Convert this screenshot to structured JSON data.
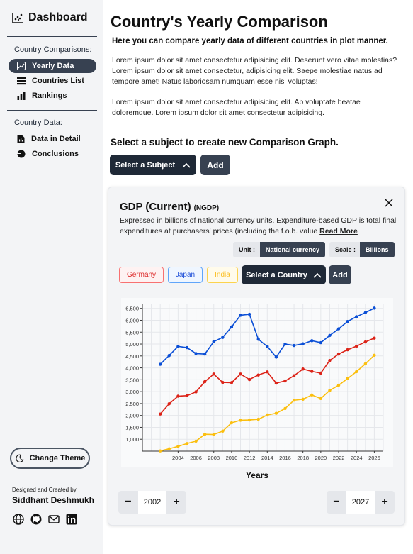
{
  "sidebar": {
    "brand": "Dashboard",
    "section1_title": "Country Comparisons:",
    "section1_items": [
      {
        "label": "Yearly Data",
        "icon": "chart-icon"
      },
      {
        "label": "Countries List",
        "icon": "list-icon"
      },
      {
        "label": "Rankings",
        "icon": "bar-chart-icon"
      }
    ],
    "section2_title": "Country Data:",
    "section2_items": [
      {
        "label": "Data in Detail",
        "icon": "document-icon"
      },
      {
        "label": "Conclusions",
        "icon": "pie-icon"
      }
    ],
    "theme_button": "Change Theme",
    "credit_small": "Designed and Created by",
    "credit_name": "Siddhant Deshmukh"
  },
  "main": {
    "title": "Country's Yearly Comparison",
    "subtitle": "Here you can compare yearly data of different countries in plot manner.",
    "paragraph1": "Lorem ipsum dolor sit amet consectetur adipisicing elit. Deserunt vero vitae molestias? Lorem ipsum dolor sit amet consectetur, adipisicing elit. Saepe molestiae natus ad tempore amet! Natus laboriosam numquam esse nisi voluptas!",
    "paragraph2": "Lorem ipsum dolor sit amet consectetur adipisicing elit. Ab voluptate beatae doloremque. Lorem ipsum dolor sit amet consectetur adipisicing.",
    "select_title": "Select a subject to create new Comparison Graph.",
    "select_subject_label": "Select a Subject",
    "add_label": "Add"
  },
  "card": {
    "title": "GDP (Current)",
    "code": "(NGDP)",
    "description": "Expressed in billions of national currency units. Expenditure-based GDP is total final expenditures at purchasers' prices (including the f.o.b. value",
    "read_more": "Read More",
    "unit_label": "Unit :",
    "unit_value": "National currency",
    "scale_label": "Scale :",
    "scale_value": "Billions",
    "countries": [
      {
        "name": "Germany",
        "color": "#dc2626"
      },
      {
        "name": "Japan",
        "color": "#1d4ed8"
      },
      {
        "name": "India",
        "color": "#fbbf24"
      }
    ],
    "select_country_label": "Select a Country",
    "add_label": "Add",
    "start_year": "2002",
    "end_year": "2027"
  },
  "chart_data": {
    "type": "line",
    "xlabel": "Years",
    "ylabel": "",
    "x": [
      2000,
      2001,
      2002,
      2003,
      2004,
      2005,
      2006,
      2007,
      2008,
      2009,
      2010,
      2011,
      2012,
      2013,
      2014,
      2015,
      2016,
      2017,
      2018,
      2019,
      2020,
      2021,
      2022,
      2023,
      2024,
      2025,
      2026
    ],
    "xticks": [
      2004,
      2006,
      2008,
      2010,
      2012,
      2014,
      2016,
      2018,
      2020,
      2022,
      2024,
      2026
    ],
    "yticks": [
      1000,
      1500,
      2000,
      2500,
      3000,
      3500,
      4000,
      4500,
      5000,
      5500,
      6000,
      6500
    ],
    "ytick_labels": [
      "1,000",
      "1,500",
      "2,000",
      "2,500",
      "3,000",
      "3,500",
      "4,000",
      "4,500",
      "5,000",
      "5,500",
      "6,000",
      "6,500"
    ],
    "ylim": [
      500,
      6700
    ],
    "xlim": [
      2000,
      2027
    ],
    "grid": true,
    "series": [
      {
        "name": "Japan",
        "color": "#0b4fd6",
        "values": [
          4150,
          4520,
          4900,
          4850,
          4600,
          4580,
          5100,
          5280,
          5720,
          6210,
          6250,
          5200,
          4900,
          4450,
          5000,
          4940,
          5010,
          5140,
          5060,
          5360,
          5640,
          5950,
          6150,
          6320,
          6510
        ]
      },
      {
        "name": "Germany",
        "color": "#dc2318",
        "values": [
          2060,
          2490,
          2810,
          2830,
          2990,
          3420,
          3740,
          3390,
          3380,
          3740,
          3510,
          3700,
          3830,
          3360,
          3450,
          3670,
          3950,
          3850,
          3780,
          4310,
          4580,
          4760,
          4910,
          5090,
          5250
        ]
      },
      {
        "name": "India",
        "color": "#fbbf0f",
        "values": [
          510,
          600,
          700,
          820,
          920,
          1210,
          1200,
          1340,
          1690,
          1800,
          1810,
          1840,
          2020,
          2090,
          2290,
          2640,
          2680,
          2860,
          2710,
          3050,
          3270,
          3550,
          3840,
          4170,
          4530
        ]
      }
    ]
  }
}
